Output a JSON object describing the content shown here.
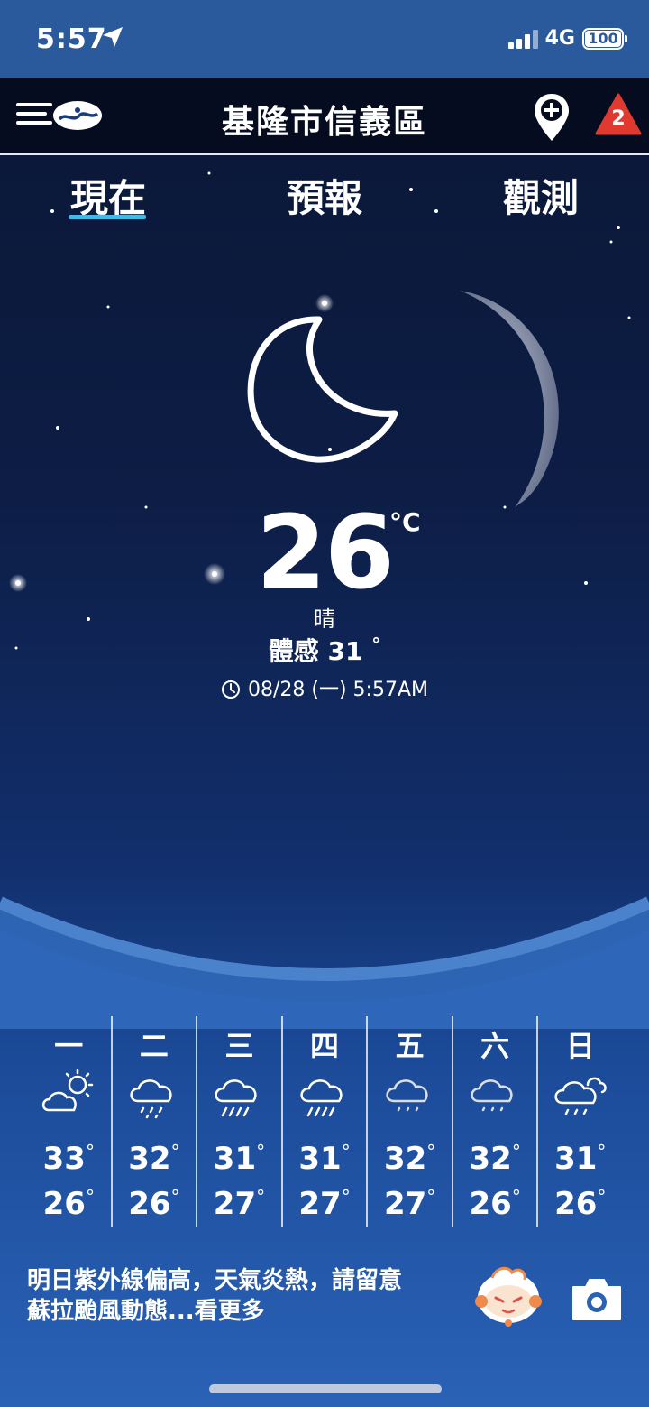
{
  "status_bar": {
    "time": "5:57",
    "network": "4G",
    "battery": "100"
  },
  "header": {
    "title": "基隆市信義區",
    "alert_count": "2"
  },
  "tabs": [
    {
      "label": "現在",
      "active": true
    },
    {
      "label": "預報",
      "active": false
    },
    {
      "label": "觀測",
      "active": false
    }
  ],
  "current": {
    "temperature": "26",
    "unit": "°C",
    "condition": "晴",
    "feels_like_label": "體感 31",
    "feels_like_deg": "°",
    "updated": "08/28 (一) 5:57AM"
  },
  "week": [
    {
      "day": "一",
      "icon": "partly-sunny-icon",
      "high": "33",
      "low": "26"
    },
    {
      "day": "二",
      "icon": "rain-cloud-icon",
      "high": "32",
      "low": "26"
    },
    {
      "day": "三",
      "icon": "heavy-rain-icon",
      "high": "31",
      "low": "27"
    },
    {
      "day": "四",
      "icon": "heavy-rain-icon",
      "high": "31",
      "low": "27"
    },
    {
      "day": "五",
      "icon": "light-rain-icon",
      "high": "32",
      "low": "27"
    },
    {
      "day": "六",
      "icon": "light-rain-icon",
      "high": "32",
      "low": "26"
    },
    {
      "day": "日",
      "icon": "cloud-rain-icon",
      "high": "31",
      "low": "26"
    }
  ],
  "degree_symbol": "°",
  "message": {
    "line1": "明日紫外線偏高，天氣炎熱，請留意",
    "line2": "蘇拉颱風動態...看更多"
  },
  "colors": {
    "status_bar": "#2b5a9c",
    "header": "#050c1f",
    "tab_underline": "#45b8e8",
    "alert": "#e03a30"
  }
}
